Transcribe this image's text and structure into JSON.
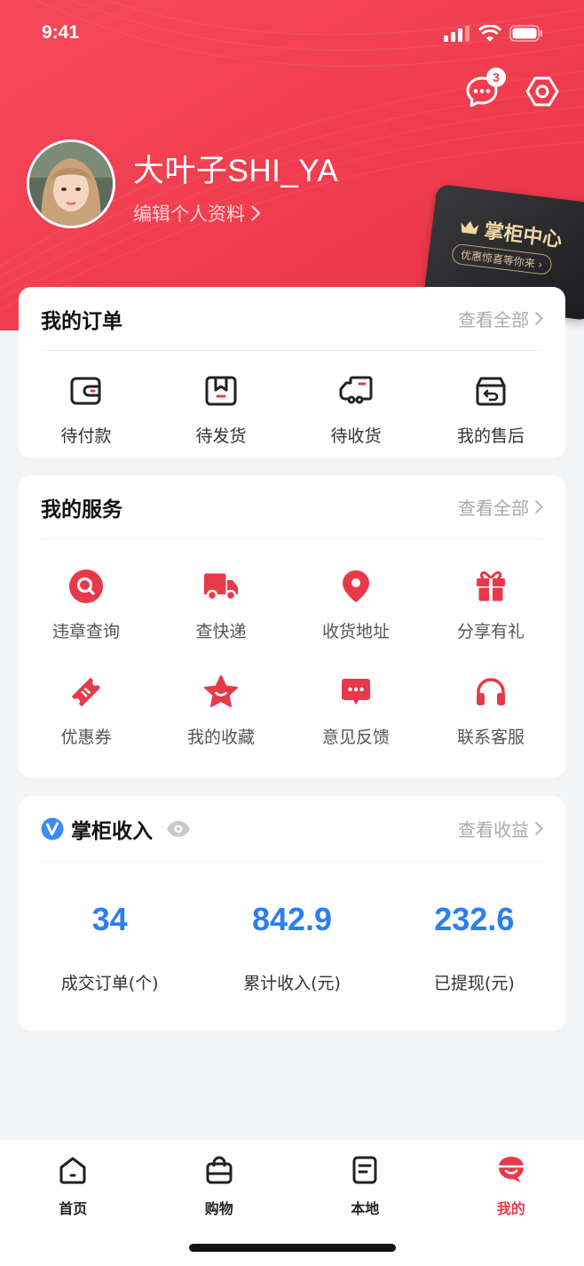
{
  "status_bar": {
    "time": "9:41"
  },
  "header": {
    "message_badge": "3",
    "username": "大叶子SHI_YA",
    "edit_profile": "编辑个人资料",
    "vip_card": {
      "title": "掌柜中心",
      "subtitle": "优惠惊喜等你来"
    }
  },
  "orders": {
    "title": "我的订单",
    "more": "查看全部",
    "items": [
      {
        "label": "待付款",
        "icon": "wallet-icon"
      },
      {
        "label": "待发货",
        "icon": "package-icon"
      },
      {
        "label": "待收货",
        "icon": "truck-icon"
      },
      {
        "label": "我的售后",
        "icon": "return-box-icon"
      }
    ]
  },
  "services": {
    "title": "我的服务",
    "more": "查看全部",
    "items": [
      {
        "label": "违章查询",
        "icon": "search-icon"
      },
      {
        "label": "查快递",
        "icon": "delivery-truck-icon"
      },
      {
        "label": "收货地址",
        "icon": "location-pin-icon"
      },
      {
        "label": "分享有礼",
        "icon": "gift-icon"
      },
      {
        "label": "优惠券",
        "icon": "coupon-icon"
      },
      {
        "label": "我的收藏",
        "icon": "star-icon"
      },
      {
        "label": "意见反馈",
        "icon": "feedback-icon"
      },
      {
        "label": "联系客服",
        "icon": "headset-icon"
      }
    ]
  },
  "income": {
    "title": "掌柜收入",
    "more": "查看收益",
    "stats": [
      {
        "value": "34",
        "label": "成交订单(个)"
      },
      {
        "value": "842.9",
        "label": "累计收入(元)"
      },
      {
        "value": "232.6",
        "label": "已提现(元)"
      }
    ]
  },
  "tabbar": {
    "items": [
      {
        "label": "首页",
        "icon": "home-icon"
      },
      {
        "label": "购物",
        "icon": "shopping-bag-icon"
      },
      {
        "label": "本地",
        "icon": "document-icon"
      },
      {
        "label": "我的",
        "icon": "profile-icon"
      }
    ],
    "active_index": 3
  },
  "colors": {
    "accent": "#e8394a",
    "link_blue": "#2b7ef3",
    "background": "#f3f4f6"
  }
}
